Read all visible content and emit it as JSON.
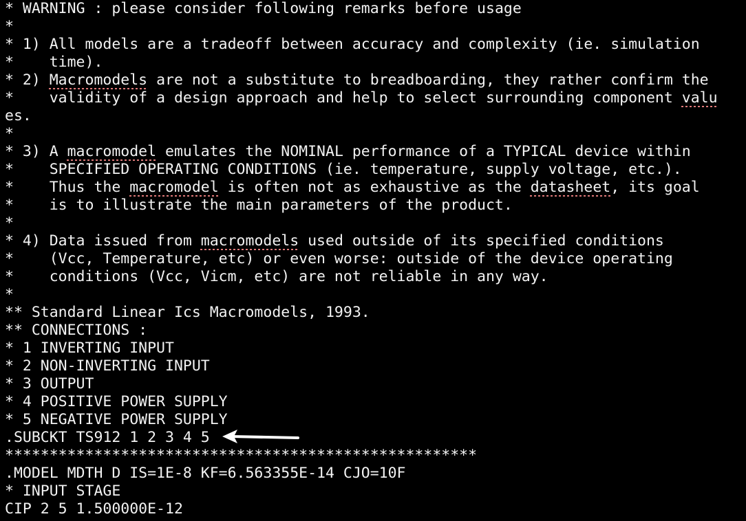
{
  "editor": {
    "warning": "WARNING : please consider following remarks before usage",
    "star": "*",
    "remark1_a": "* 1) All models are a tradeoff between accuracy and complexity (ie. simulation",
    "remark1_b": "*    time).",
    "remark2_a_pre": "* 2) ",
    "remark2_a_word": "Macromodels",
    "remark2_a_post": " are not a substitute to breadboarding, they rather confirm the",
    "remark2_b_pre": "*    validity of a design approach and help to select surrounding component ",
    "remark2_b_word": "valu",
    "remark2_c": "es.",
    "remark3_a_pre": "* 3) A ",
    "remark3_a_word": "macromodel",
    "remark3_a_post": " emulates the NOMINAL performance of a TYPICAL device within",
    "remark3_b": "*    SPECIFIED OPERATING CONDITIONS (ie. temperature, supply voltage, etc.).",
    "remark3_c_pre": "*    Thus the ",
    "remark3_c_word1": "macromodel",
    "remark3_c_mid": " is often not as exhaustive as the ",
    "remark3_c_word2": "datasheet",
    "remark3_c_post": ", its goal",
    "remark3_d": "*    is to illustrate the main parameters of the product.",
    "remark4_a_pre": "* 4) Data issued from ",
    "remark4_a_word": "macromodels",
    "remark4_a_post": " used outside of its specified conditions",
    "remark4_b": "*    (Vcc, Temperature, etc) or even worse: outside of the device operating",
    "remark4_c": "*    conditions (Vcc, Vicm, etc) are not reliable in any way.",
    "standard": "** Standard Linear Ics Macromodels, 1993.",
    "connections": "** CONNECTIONS :",
    "conn1": "* 1 INVERTING INPUT",
    "conn2": "* 2 NON-INVERTING INPUT",
    "conn3": "* 3 OUTPUT",
    "conn4": "* 4 POSITIVE POWER SUPPLY",
    "conn5": "* 5 NEGATIVE POWER SUPPLY",
    "subckt": ".SUBCKT TS912 1 2 3 4 5",
    "separator": "*****************************************************",
    "model": ".MODEL MDTH D IS=1E-8 KF=6.563355E-14 CJO=10F",
    "input_stage": "* INPUT STAGE",
    "cip": "CIP 2 5 1.500000E-12"
  },
  "colors": {
    "background": "#000000",
    "text": "#f2f2f2",
    "spellcheck": "#e07a7a",
    "arrow": "#ffffff"
  },
  "icons": {
    "annotation": "left-arrow-icon"
  }
}
